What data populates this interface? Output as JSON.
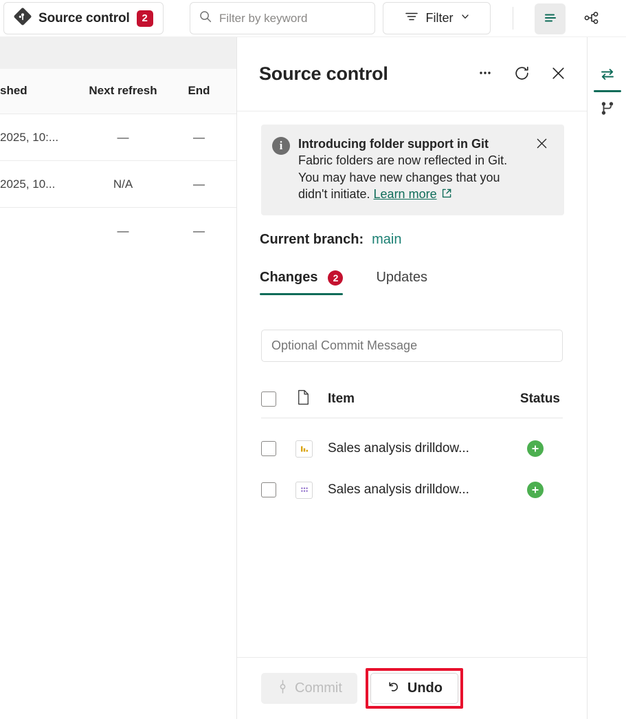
{
  "toolbar": {
    "source_control_label": "Source control",
    "source_control_badge": "2",
    "source_control_icon": "git-logo-icon",
    "search_placeholder": "Filter by keyword",
    "search_value": "",
    "search_icon": "search-icon",
    "filter_label": "Filter",
    "filter_icon": "filter-lines-icon",
    "filter_chevron_icon": "chevron-down-icon",
    "view_list_icon": "list-view-icon",
    "lineage_icon": "lineage-share-icon"
  },
  "background_table": {
    "columns": [
      "shed",
      "Next refresh",
      "End"
    ],
    "rows": [
      [
        "2025, 10:...",
        "—",
        "—"
      ],
      [
        "2025, 10...",
        "N/A",
        "—"
      ],
      [
        "",
        "—",
        "—"
      ]
    ]
  },
  "panel": {
    "title": "Source control",
    "more_icon": "ellipsis-icon",
    "refresh_icon": "refresh-icon",
    "close_icon": "close-icon",
    "banner": {
      "info_icon": "info-icon",
      "title": "Introducing folder support in Git",
      "body": "Fabric folders are now reflected in Git. You may have new changes that you didn't initiate.",
      "link_label": "Learn more",
      "link_icon": "external-link-icon",
      "close_icon": "close-icon",
      "title_bold_part_1": "Introducing folder support in",
      "title_bold_part_2": "Git"
    },
    "branch": {
      "label": "Current branch:",
      "name": "main"
    },
    "tabs": [
      {
        "label": "Changes",
        "badge": "2",
        "active": true
      },
      {
        "label": "Updates",
        "badge": "",
        "active": false
      }
    ],
    "commit_message": {
      "placeholder": "Optional Commit Message",
      "value": ""
    },
    "items_table": {
      "headers": {
        "item": "Item",
        "status": "Status",
        "item_icon": "document-icon",
        "select_all_checkbox": "select-all-checkbox"
      },
      "rows": [
        {
          "name": "Sales analysis drilldow...",
          "icon": "report-chart-icon",
          "status": "added",
          "status_icon": "plus-circle-icon",
          "checked": false
        },
        {
          "name": "Sales analysis drilldow...",
          "icon": "semantic-model-icon",
          "status": "added",
          "status_icon": "plus-circle-icon",
          "checked": false
        }
      ]
    },
    "footer": {
      "commit_label": "Commit",
      "commit_icon": "commit-icon",
      "commit_disabled": true,
      "undo_label": "Undo",
      "undo_icon": "undo-arrow-icon",
      "undo_highlighted": true
    }
  },
  "right_rail": {
    "items": [
      {
        "icon": "sync-arrows-icon",
        "active": true
      },
      {
        "icon": "git-branch-icon",
        "active": false
      }
    ]
  },
  "colors": {
    "accent_teal": "#0f6c59",
    "badge_red": "#c4112f",
    "status_green": "#4caf50",
    "highlight_red": "#e8112d",
    "branch_teal": "#1a7f72"
  }
}
